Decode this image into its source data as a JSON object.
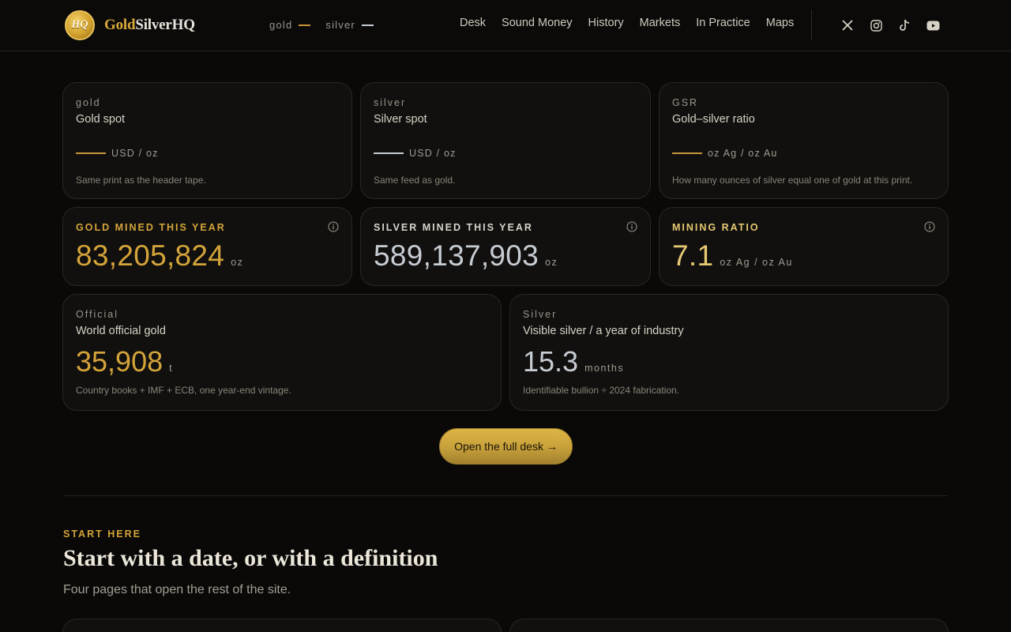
{
  "header": {
    "logo_badge": "HQ",
    "logo_gold": "Gold",
    "logo_rest": "SilverHQ",
    "tape": [
      {
        "label": "gold",
        "color": "#c9953a"
      },
      {
        "label": "silver",
        "color": "#c7ccd3"
      }
    ],
    "nav": [
      "Desk",
      "Sound Money",
      "History",
      "Markets",
      "In Practice",
      "Maps"
    ],
    "socials": [
      "x-icon",
      "instagram-icon",
      "tiktok-icon",
      "youtube-icon"
    ]
  },
  "spot_cards": [
    {
      "eyebrow": "gold",
      "title": "Gold spot",
      "unit": "USD / oz",
      "line_color": "#c9953a",
      "note": "Same print as the header tape."
    },
    {
      "eyebrow": "silver",
      "title": "Silver spot",
      "unit": "USD / oz",
      "line_color": "#c7ccd3",
      "note": "Same feed as gold."
    },
    {
      "eyebrow": "GSR",
      "title": "Gold–silver ratio",
      "unit": "oz Ag / oz Au",
      "line_color": "#c9953a",
      "note": "How many ounces of silver equal one of gold at this print."
    }
  ],
  "mined_cards": [
    {
      "label": "GOLD MINED THIS YEAR",
      "value": "83,205,824",
      "unit": "oz",
      "label_color": "#d4a43a"
    },
    {
      "label": "SILVER MINED THIS YEAR",
      "value": "589,137,903",
      "unit": "oz",
      "label_color": "#d8d4cc"
    },
    {
      "label": "MINING RATIO",
      "value": "7.1",
      "unit": "oz Ag / oz Au",
      "label_color": "#e6c873"
    }
  ],
  "official_card": {
    "eyebrow": "Official",
    "title": "World official gold",
    "value": "35,908",
    "unit": "t",
    "note": "Country books + IMF + ECB, one year-end vintage."
  },
  "silver_card": {
    "eyebrow": "Silver",
    "title": "Visible silver / a year of industry",
    "value": "15.3",
    "unit": "months",
    "note": "Identifiable bullion ÷ 2024 fabrication."
  },
  "cta": {
    "label": "Open the full desk →"
  },
  "start": {
    "kicker": "START HERE",
    "headline": "Start with a date, or with a definition",
    "sub": "Four pages that open the rest of the site."
  }
}
